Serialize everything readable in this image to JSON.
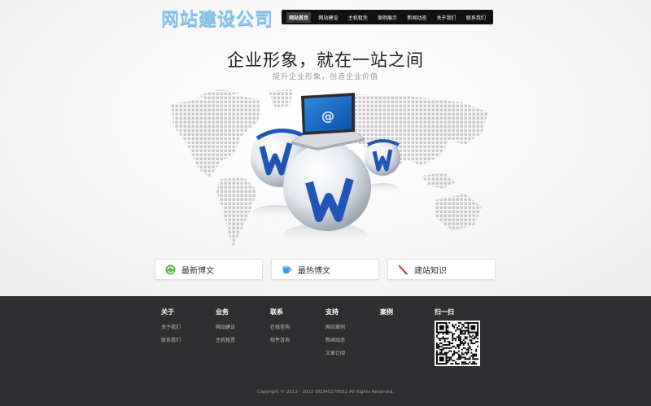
{
  "header": {
    "logo_text": "网站建设公司",
    "nav": [
      {
        "label": "网站首页",
        "active": true
      },
      {
        "label": "网站建设",
        "active": false
      },
      {
        "label": "主机租凭",
        "active": false
      },
      {
        "label": "案例展示",
        "active": false
      },
      {
        "label": "新闻动态",
        "active": false
      },
      {
        "label": "关于我们",
        "active": false
      },
      {
        "label": "联系我们",
        "active": false
      }
    ]
  },
  "hero": {
    "title": "企业形象，就在一站之间",
    "subtitle": "提升企业形象，创造企业价值"
  },
  "cards": [
    {
      "label": "最新博文",
      "icon": "refresh-icon"
    },
    {
      "label": "最热博文",
      "icon": "cup-icon"
    },
    {
      "label": "建站知识",
      "icon": "pencil-icon"
    }
  ],
  "footer": {
    "columns": [
      {
        "heading": "关于",
        "links": [
          "关于我们",
          "联系我们"
        ]
      },
      {
        "heading": "业务",
        "links": [
          "网站建设",
          "主机租赁"
        ]
      },
      {
        "heading": "联系",
        "links": [
          "在线咨询",
          "邮件咨询"
        ]
      },
      {
        "heading": "支持",
        "links": [
          "网站案例",
          "新闻动态",
          "文章订阅"
        ]
      },
      {
        "heading": "案例",
        "links": []
      },
      {
        "heading": "扫一扫",
        "links": []
      }
    ],
    "copyright": "Copyright © 2013 - 2015 QQ345179552 All Rights Reserved."
  },
  "colors": {
    "logo": "#8ec6ec",
    "nav_bg": "#111111",
    "footer_bg": "#2f2f31",
    "accent_blue": "#2156b8"
  }
}
